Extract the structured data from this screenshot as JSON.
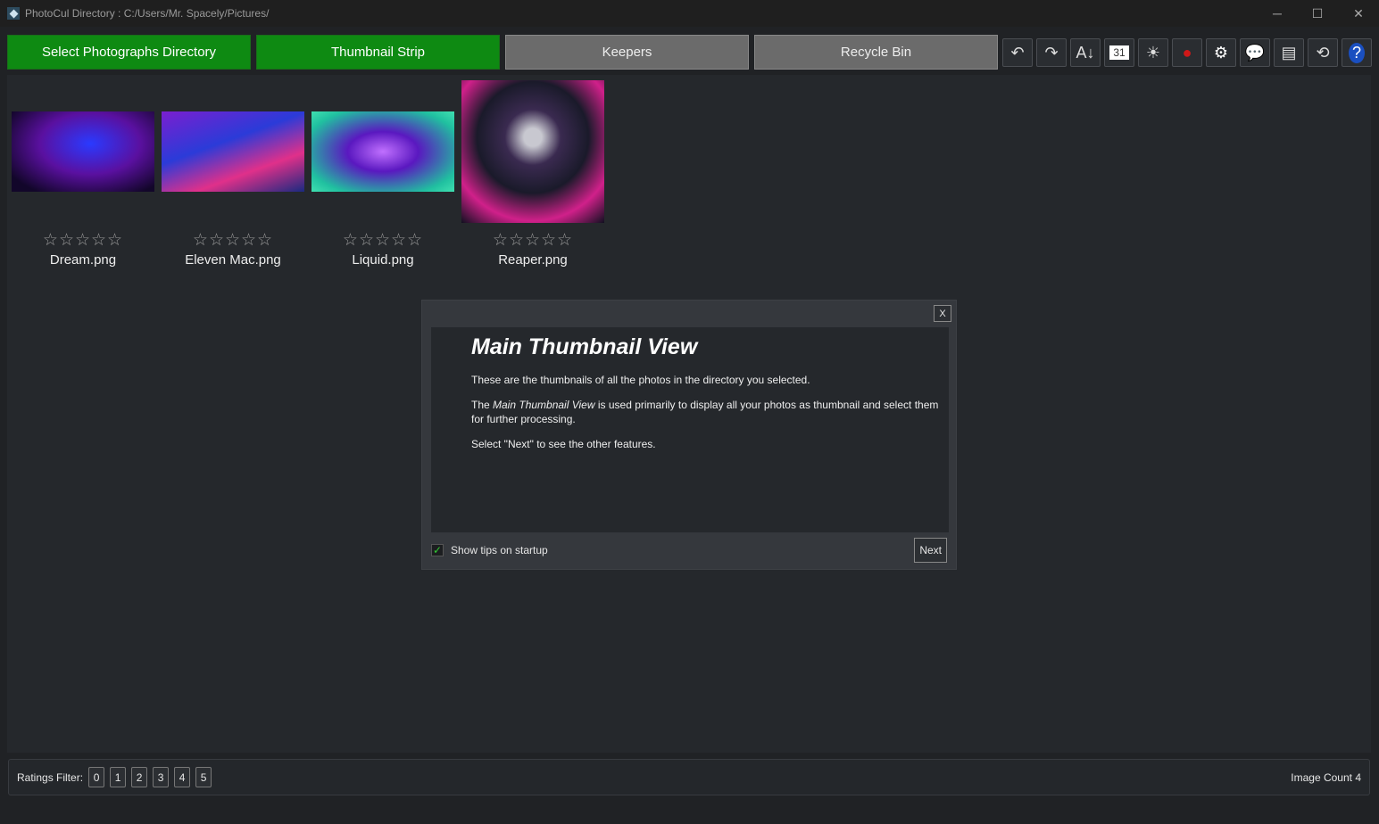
{
  "window": {
    "title": "PhotoCul  Directory : C:/Users/Mr. Spacely/Pictures/",
    "minimize": "─",
    "maximize": "☐",
    "close": "✕"
  },
  "toolbar": {
    "select_dir": "Select Photographs Directory",
    "thumb_strip": "Thumbnail Strip",
    "keepers": "Keepers",
    "recycle": "Recycle Bin",
    "icons": [
      {
        "name": "undo-icon",
        "glyph": "↶"
      },
      {
        "name": "redo-icon",
        "glyph": "↷"
      },
      {
        "name": "sort-az-icon",
        "glyph": "A↓"
      },
      {
        "name": "calendar-icon",
        "glyph": "31"
      },
      {
        "name": "lightbulb-icon",
        "glyph": "☀"
      },
      {
        "name": "ladybug-icon",
        "glyph": "●"
      },
      {
        "name": "settings-icon",
        "glyph": "⚙"
      },
      {
        "name": "chat-icon",
        "glyph": "💬"
      },
      {
        "name": "image-stack-icon",
        "glyph": "▤"
      },
      {
        "name": "image-search-icon",
        "glyph": "⟲"
      },
      {
        "name": "help-icon",
        "glyph": "?"
      }
    ]
  },
  "thumbnails": [
    {
      "name": "Dream.png",
      "stars": "☆☆☆☆☆"
    },
    {
      "name": "Eleven Mac.png",
      "stars": "☆☆☆☆☆"
    },
    {
      "name": "Liquid.png",
      "stars": "☆☆☆☆☆"
    },
    {
      "name": "Reaper.png",
      "stars": "☆☆☆☆☆"
    }
  ],
  "dialog": {
    "close": "X",
    "title": "Main Thumbnail View",
    "p1": "These are the thumbnails of all the photos in the directory you selected.",
    "p2_pre": "The ",
    "p2_em": "Main Thumbnail View",
    "p2_post": " is used primarily to display all your photos as thumbnail and select them for further processing.",
    "p3": "Select \"Next\" to see the other features.",
    "checkbox_label": "Show tips on startup",
    "checked": true,
    "next": "Next"
  },
  "bottom": {
    "ratings_label": "Ratings Filter:",
    "ratings": [
      "0",
      "1",
      "2",
      "3",
      "4",
      "5"
    ],
    "image_count": "Image Count 4"
  }
}
